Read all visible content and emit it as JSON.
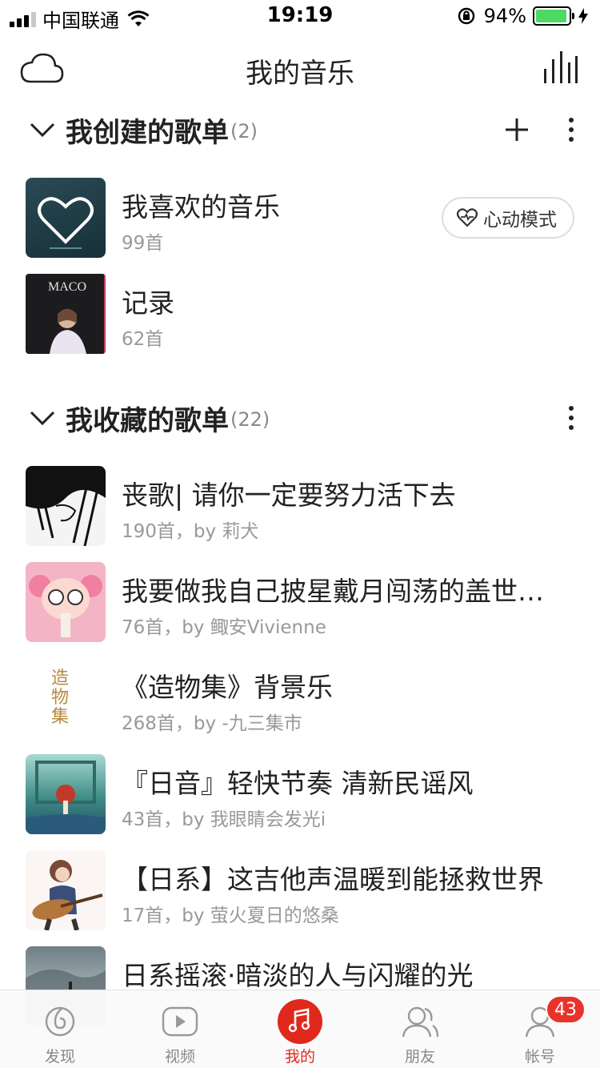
{
  "status_bar": {
    "carrier": "中国联通",
    "time": "19:19",
    "battery": "94%",
    "battery_level": 0.94
  },
  "nav": {
    "title": "我的音乐",
    "left_icon": "cloud-icon",
    "right_icon": "equalizer-bars-icon"
  },
  "created": {
    "title": "我创建的歌单",
    "count": "(2)",
    "heart_mode_label": "心动模式",
    "playlists": [
      {
        "name": "我喜欢的音乐",
        "sub": "99首"
      },
      {
        "name": "记录",
        "sub": "62首",
        "cover_text": "MACO"
      }
    ]
  },
  "collected": {
    "title": "我收藏的歌单",
    "count": "(22)",
    "playlists": [
      {
        "name": "丧歌| 请你一定要努力活下去",
        "sub": "190首，by 莉犬"
      },
      {
        "name": "我要做我自己披星戴月闯荡的盖世…",
        "sub": "76首，by 鲰安Vivienne"
      },
      {
        "name": "《造物集》背景乐",
        "sub": "268首，by -九三集市",
        "cover_text": "造物集"
      },
      {
        "name": "『日音』轻快节奏 清新民谣风",
        "sub": "43首，by 我眼睛会发光i"
      },
      {
        "name": "【日系】这吉他声温暖到能拯救世界",
        "sub": "17首，by 萤火夏日的悠桑"
      },
      {
        "name": "日系摇滚·暗淡的人与闪耀的光",
        "sub": ""
      }
    ]
  },
  "tabbar": {
    "tabs": [
      {
        "label": "发现"
      },
      {
        "label": "视频"
      },
      {
        "label": "我的"
      },
      {
        "label": "朋友"
      },
      {
        "label": "帐号"
      }
    ],
    "account_badge": "43",
    "active_color": "#e0281c"
  }
}
